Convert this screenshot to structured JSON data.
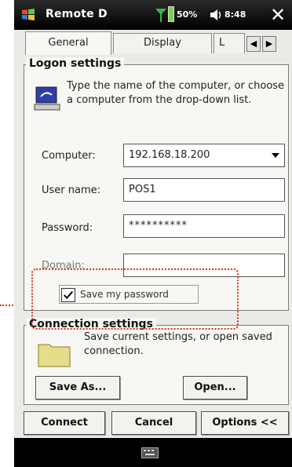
{
  "statusbar": {
    "title": "Remote D",
    "battery": "50%",
    "time": "8:48"
  },
  "tabs": [
    {
      "label": "General",
      "active": true
    },
    {
      "label": "Display",
      "active": false
    },
    {
      "label": "L",
      "active": false
    }
  ],
  "logon": {
    "group_title": "Logon settings",
    "description": "Type the name of the computer, or choose a computer from the drop-down list.",
    "computer_label": "Computer:",
    "computer_value": "192.168.18.200",
    "username_label": "User name:",
    "username_value": "POS1",
    "password_label": "Password:",
    "password_value": "**********",
    "domain_label": "Domain:",
    "domain_value": "",
    "save_password_label": "Save my password",
    "save_password_checked": true
  },
  "connection": {
    "group_title": "Connection settings",
    "description": "Save current settings, or open saved connection.",
    "save_as_label": "Save As...",
    "open_label": "Open..."
  },
  "actions": {
    "connect_label": "Connect",
    "cancel_label": "Cancel",
    "options_label": "Options <<"
  },
  "colors": {
    "callout": "#e0301e",
    "background": "#f7f7f3"
  }
}
